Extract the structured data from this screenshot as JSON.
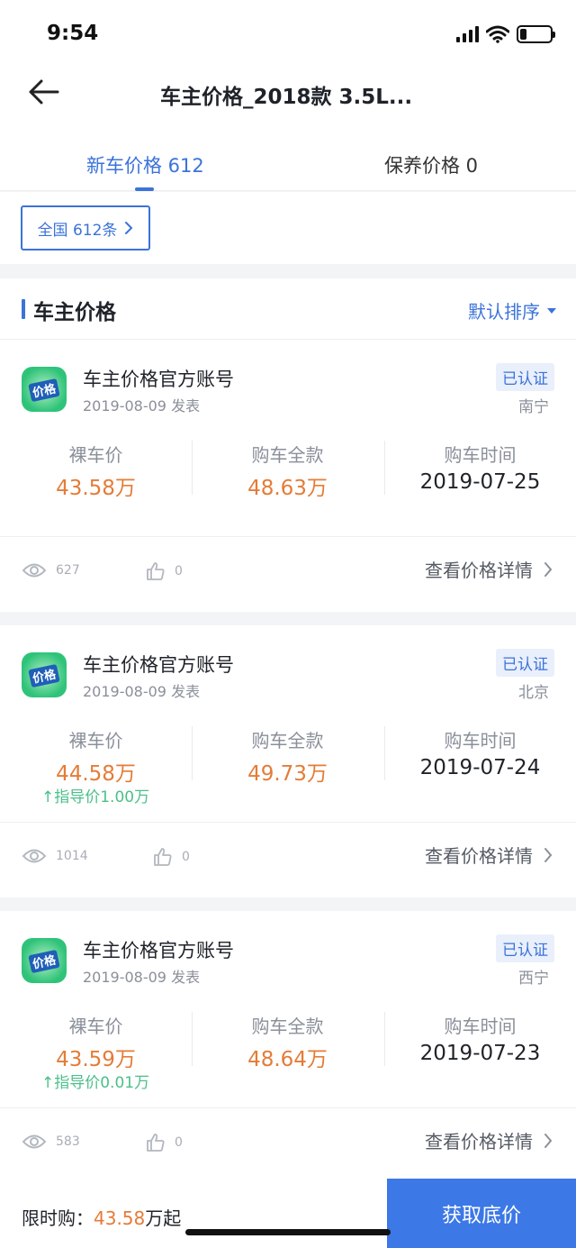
{
  "status_bar": {
    "time": "9:54",
    "battery_level": 0.22
  },
  "header": {
    "title": "车主价格_2018款 3.5L..."
  },
  "tabs": [
    {
      "label": "新车价格 612",
      "active": true
    },
    {
      "label": "保养价格 0",
      "active": false
    }
  ],
  "filter": {
    "region_label": "全国 612条"
  },
  "section": {
    "title": "车主价格",
    "sort_label": "默认排序"
  },
  "labels": {
    "bare_price": "裸车价",
    "total_price": "购车全款",
    "purchase_time": "购车时间",
    "view_detail": "查看价格详情"
  },
  "posts": [
    {
      "avatar_text": "价格",
      "user": "车主价格官方账号",
      "date": "2019-08-09 发表",
      "verified": "已认证",
      "city": "南宁",
      "bare_price": "43.58万",
      "total_price": "48.63万",
      "purchase_time": "2019-07-25",
      "guide_note": "",
      "views": "627",
      "likes": "0"
    },
    {
      "avatar_text": "价格",
      "user": "车主价格官方账号",
      "date": "2019-08-09 发表",
      "verified": "已认证",
      "city": "北京",
      "bare_price": "44.58万",
      "total_price": "49.73万",
      "purchase_time": "2019-07-24",
      "guide_note": "↑指导价1.00万",
      "views": "1014",
      "likes": "0"
    },
    {
      "avatar_text": "价格",
      "user": "车主价格官方账号",
      "date": "2019-08-09 发表",
      "verified": "已认证",
      "city": "西宁",
      "bare_price": "43.59万",
      "total_price": "48.64万",
      "purchase_time": "2019-07-23",
      "guide_note": "↑指导价0.01万",
      "views": "583",
      "likes": "0"
    }
  ],
  "bottom": {
    "promo_prefix": "限时购：",
    "promo_price": "43.58",
    "promo_suffix": "万起",
    "cta_label": "获取底价"
  },
  "colors": {
    "accent": "#3b73d9",
    "price_orange": "#e47c37",
    "guide_green": "#4cbf8a",
    "avatar_green": "#2fc37a"
  }
}
